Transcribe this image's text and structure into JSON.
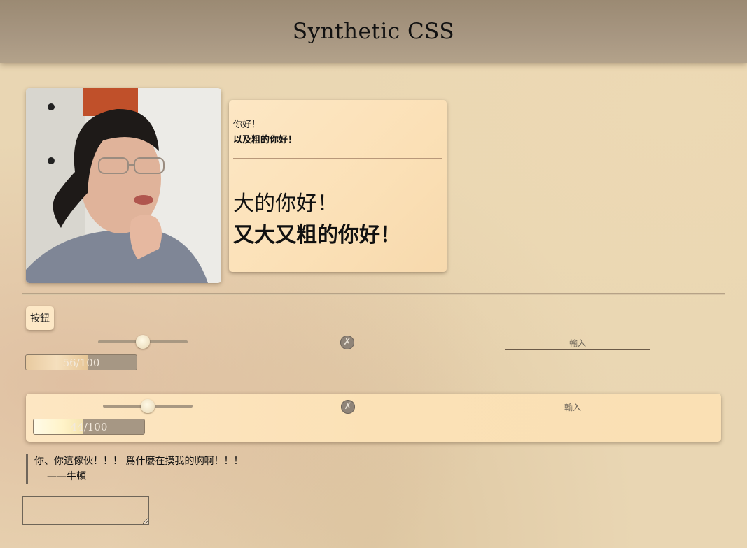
{
  "header": {
    "title": "Synthetic CSS"
  },
  "card": {
    "greeting": "你好！",
    "greeting_bold": "以及粗的你好！",
    "greeting_big": "大的你好！",
    "greeting_big_bold": "又大又粗的你好！"
  },
  "controls": {
    "button_label": "按鈕",
    "clear_glyph": "✗",
    "input_placeholder": "輸入",
    "row1": {
      "slider_value": 0.5,
      "progress_label": "56/100",
      "progress_value": 56
    },
    "row2": {
      "slider_value": 0.5,
      "progress_label": "44/100",
      "progress_value": 44
    }
  },
  "quote": {
    "text": "你、你這傢伙！！！ 爲什麼在摸我的胸啊！！！",
    "cite": "——牛頓"
  },
  "colors": {
    "accent": "#fde8c6",
    "header_bg": "#a89782",
    "page_bg": "#e9d6b3"
  }
}
